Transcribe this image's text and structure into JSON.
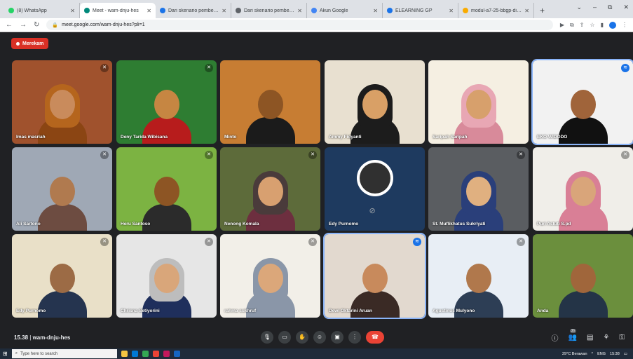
{
  "browser": {
    "tabs": [
      {
        "label": "(8) WhatsApp",
        "favicon_color": "#25d366",
        "active": false
      },
      {
        "label": "Meet - wam-dnju-hes",
        "favicon_color": "#00897b",
        "active": true
      },
      {
        "label": "Dari skenario pembelajaran yan...",
        "favicon_color": "#1a73e8",
        "active": false
      },
      {
        "label": "Dari skenario pembelajaran yan...",
        "favicon_color": "#5f6368",
        "active": false
      },
      {
        "label": "Akun Google",
        "favicon_color": "#4285f4",
        "active": false
      },
      {
        "label": "ELEARNING GP",
        "favicon_color": "#1a73e8",
        "active": false
      },
      {
        "label": "modul-a7-25-bbgp-diy-eco-w...",
        "favicon_color": "#f9ab00",
        "active": false
      }
    ],
    "url": "meet.google.com/wam-dnju-hes?pli=1",
    "window_controls": [
      "⌄",
      "–",
      "⧉",
      "✕"
    ]
  },
  "meet": {
    "record_label": "Merekam",
    "meeting_time": "15.38",
    "meeting_code": "wam-dnju-hes",
    "participant_count": "36",
    "participants": [
      {
        "name": "Imas masriah",
        "bg": "#a0522d",
        "skin": "#c98b5c",
        "hijab": "#b5651d",
        "shirt": "#8b4513",
        "icon": "mic-off"
      },
      {
        "name": "Deny Tarida Wibisana",
        "bg": "#2e7d32",
        "skin": "#c68642",
        "hijab": "",
        "shirt": "#b71c1c",
        "icon": "mic-off"
      },
      {
        "name": "Minto",
        "bg": "#c77d33",
        "skin": "#8d5524",
        "hijab": "",
        "shirt": "#1b1b1b",
        "icon": "none"
      },
      {
        "name": "Ammy Fidyanti",
        "bg": "#e8e0d0",
        "skin": "#d9a066",
        "hijab": "#1c1c1c",
        "shirt": "#1c1c1c",
        "icon": "none"
      },
      {
        "name": "Saripah Saripah",
        "bg": "#f5efe2",
        "skin": "#d7a06c",
        "hijab": "#e8a7b4",
        "shirt": "#d88a9a",
        "icon": "none"
      },
      {
        "name": "EKO WIDODO",
        "bg": "#f2f2f2",
        "skin": "#a0643a",
        "hijab": "",
        "shirt": "#111111",
        "icon": "speaking"
      },
      {
        "name": "Ali Sartono",
        "bg": "#9fa8b5",
        "skin": "#b07a4f",
        "hijab": "",
        "shirt": "#6d4c41",
        "icon": "mic-off"
      },
      {
        "name": "Heru Santoso",
        "bg": "#7cb342",
        "skin": "#8d5524",
        "hijab": "",
        "shirt": "#2b2b2b",
        "icon": "mic-off"
      },
      {
        "name": "Nenong Komala",
        "bg": "#5d6b3a",
        "skin": "#d8a070",
        "hijab": "#4a3b3b",
        "shirt": "#6d2f3f",
        "icon": "mic-off"
      },
      {
        "name": "Edy Purnomo",
        "bg": "#1e3a5f",
        "skin": "",
        "hijab": "",
        "shirt": "",
        "icon": "camera-off"
      },
      {
        "name": "St. Muflikhatus Sukriyati",
        "bg": "#5a5d61",
        "skin": "#e0b080",
        "hijab": "#2a3f7a",
        "shirt": "#2a3f7a",
        "icon": "mic-off"
      },
      {
        "name": "Puri Astuti S.pd",
        "bg": "#f0eee9",
        "skin": "#d9a57a",
        "hijab": "#d97f96",
        "shirt": "#d97f96",
        "icon": "mic-off"
      },
      {
        "name": "Edy Purnomo",
        "bg": "#e9e0c8",
        "skin": "#9c6b45",
        "hijab": "",
        "shirt": "#25344f",
        "icon": "mic-off"
      },
      {
        "name": "Chrisna Setiyorini",
        "bg": "#e6e6e6",
        "skin": "#d9a67a",
        "hijab": "#bdbdbd",
        "shirt": "#1f2f5c",
        "icon": "mic-off"
      },
      {
        "name": "rahma sukhruf",
        "bg": "#f2efe8",
        "skin": "#dba77a",
        "hijab": "#8a96a8",
        "shirt": "#8a96a8",
        "icon": "mic-off"
      },
      {
        "name": "Dewi Oktarini Aruan",
        "bg": "#e2d9cf",
        "skin": "#c88a5c",
        "hijab": "",
        "shirt": "#3a2a25",
        "icon": "speaking"
      },
      {
        "name": "Agustinus Mulyono",
        "bg": "#e8eef5",
        "skin": "#b0784c",
        "hijab": "",
        "shirt": "#2d3e55",
        "icon": "mic-off"
      },
      {
        "name": "Anda",
        "bg": "#6b8f3d",
        "skin": "#a0663b",
        "hijab": "",
        "shirt": "#243447",
        "icon": "none"
      }
    ],
    "controls": [
      {
        "name": "microphone-icon",
        "glyph": "🎙"
      },
      {
        "name": "camera-icon",
        "glyph": "▭"
      },
      {
        "name": "raise-hand-icon",
        "glyph": "✋"
      },
      {
        "name": "emoji-icon",
        "glyph": "☺"
      },
      {
        "name": "present-icon",
        "glyph": "▣"
      },
      {
        "name": "more-options-icon",
        "glyph": "⋮"
      }
    ],
    "end_call_glyph": "☎",
    "right_controls": [
      {
        "name": "info-icon",
        "glyph": "ⓘ"
      },
      {
        "name": "people-icon",
        "glyph": "👥"
      },
      {
        "name": "chat-icon",
        "glyph": "▤"
      },
      {
        "name": "activities-icon",
        "glyph": "⚘"
      },
      {
        "name": "host-controls-icon",
        "glyph": "⚿"
      }
    ]
  },
  "taskbar": {
    "search_placeholder": "Type here to search",
    "weather": "29°C Berawan",
    "language": "ENG",
    "time": "15:38"
  }
}
